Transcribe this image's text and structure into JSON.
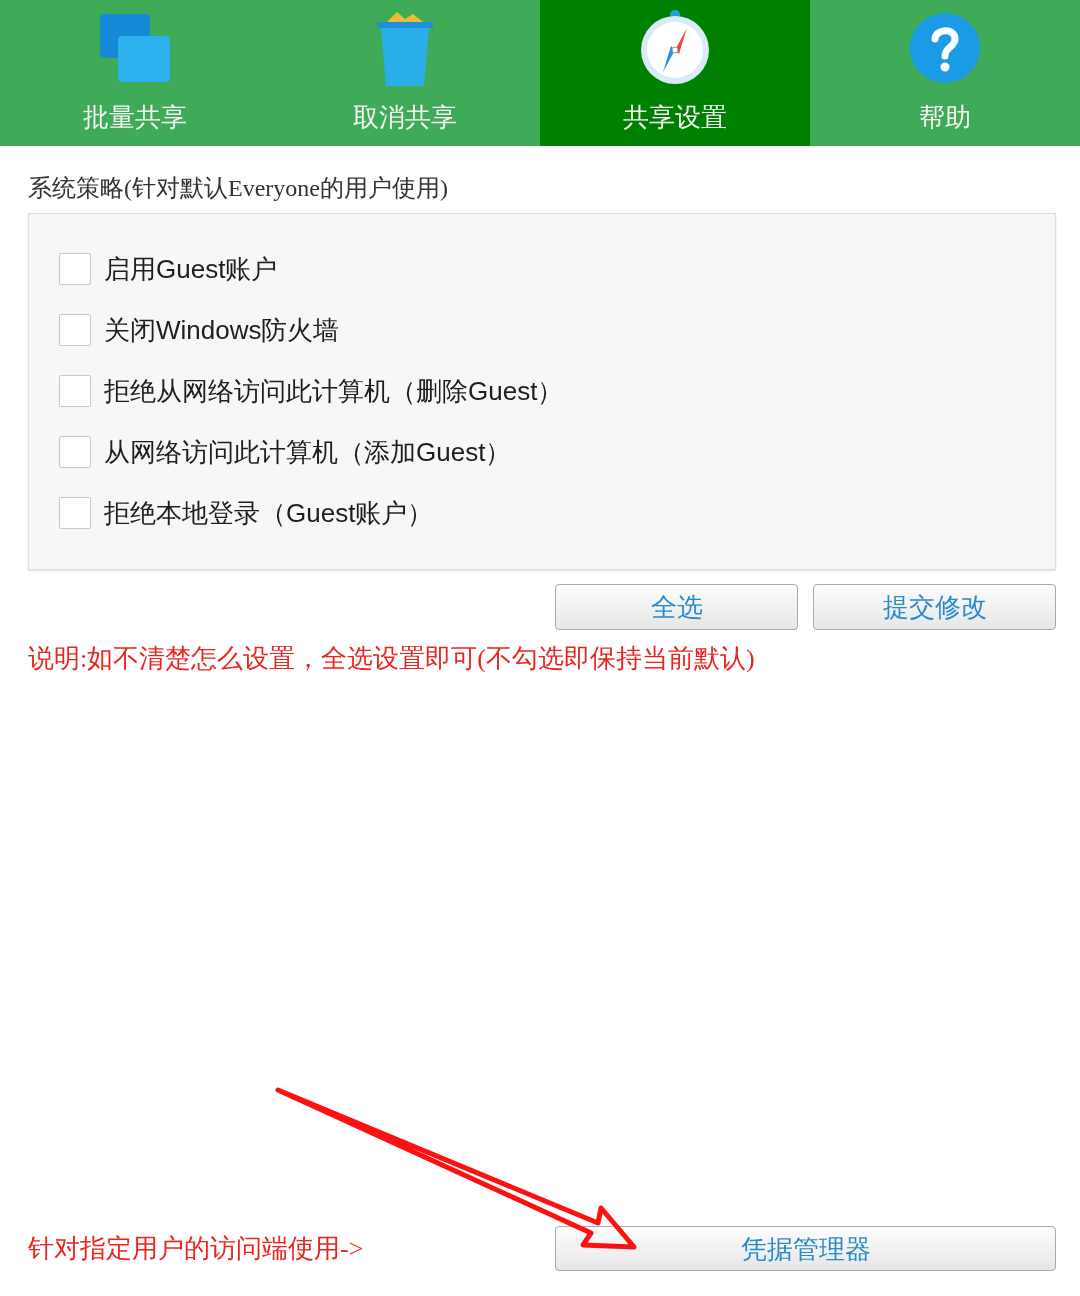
{
  "tabs": [
    {
      "label": "批量共享",
      "kind": "batch",
      "selected": false
    },
    {
      "label": "取消共享",
      "kind": "cancel",
      "selected": false
    },
    {
      "label": "共享设置",
      "kind": "settings",
      "selected": true
    },
    {
      "label": "帮助",
      "kind": "help",
      "selected": false
    }
  ],
  "policy": {
    "title": "系统策略(针对默认Everyone的用户使用)",
    "options": [
      {
        "label": "启用Guest账户",
        "checked": false
      },
      {
        "label": "关闭Windows防火墙",
        "checked": false
      },
      {
        "label": "拒绝从网络访问此计算机（删除Guest）",
        "checked": false
      },
      {
        "label": "从网络访问此计算机（添加Guest）",
        "checked": false
      },
      {
        "label": "拒绝本地登录（Guest账户）",
        "checked": false
      }
    ]
  },
  "buttons": [
    "全选",
    "提交修改"
  ],
  "note": "说明:如不清楚怎么设置，全选设置即可(不勾选即保持当前默认)",
  "footer": {
    "hint": "针对指定用户的访问端使用->",
    "button": "凭据管理器"
  }
}
